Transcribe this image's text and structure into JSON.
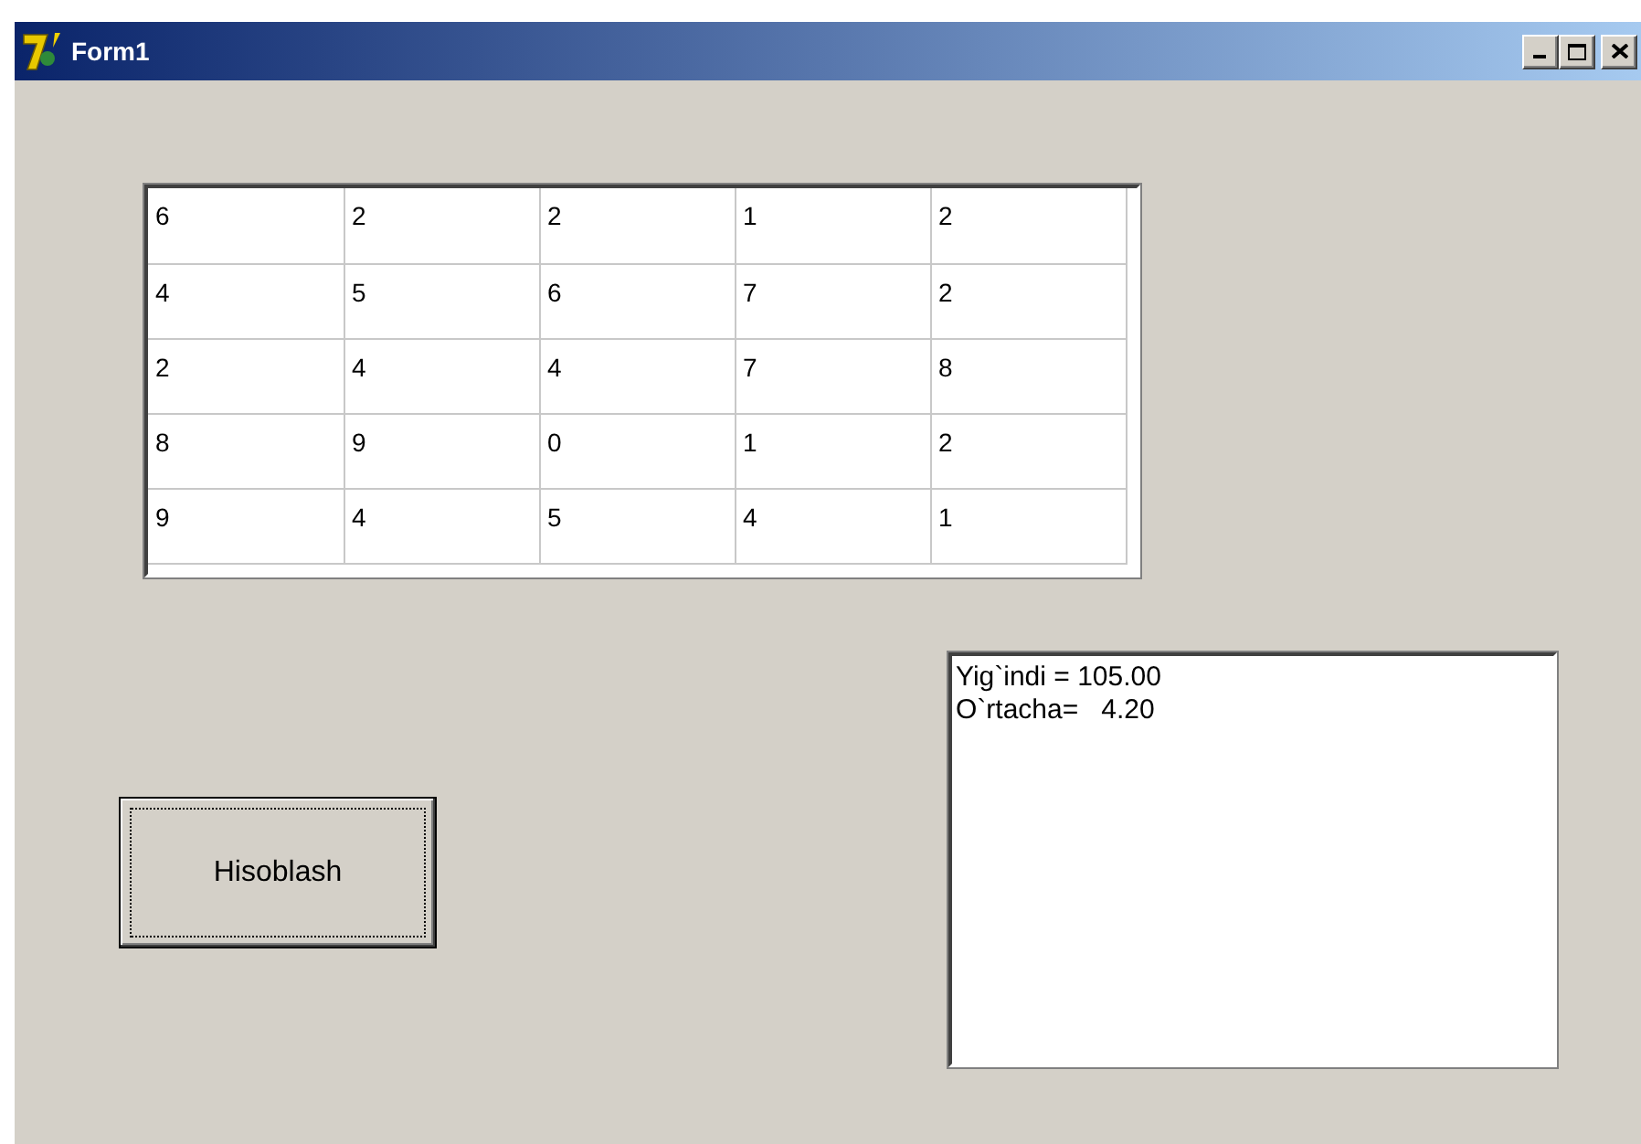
{
  "window": {
    "title": "Form1",
    "controls": [
      {
        "kind": "minimize"
      },
      {
        "kind": "maximize"
      },
      {
        "kind": "close"
      }
    ]
  },
  "grid": {
    "rows": [
      [
        "6",
        "2",
        "2",
        "1",
        "2"
      ],
      [
        "4",
        "5",
        "6",
        "7",
        "2"
      ],
      [
        "2",
        "4",
        "4",
        "7",
        "8"
      ],
      [
        "8",
        "9",
        "0",
        "1",
        "2"
      ],
      [
        "9",
        "4",
        "5",
        "4",
        "1"
      ]
    ]
  },
  "button": {
    "label": "Hisoblash",
    "focused": true
  },
  "memo": {
    "lines": [
      "Yig`indi = 105.00",
      "O`rtacha=   4.20"
    ]
  }
}
